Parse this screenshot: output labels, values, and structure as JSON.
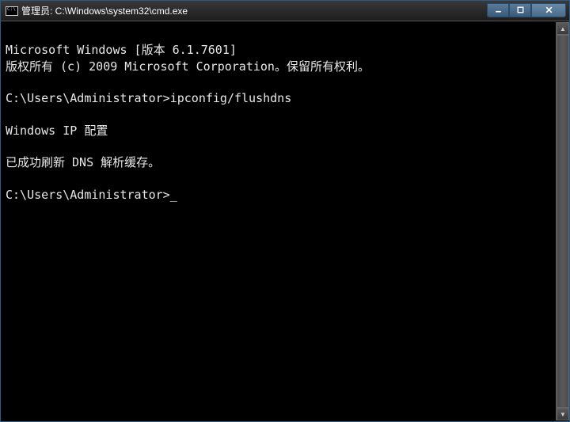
{
  "window": {
    "title": "管理员: C:\\Windows\\system32\\cmd.exe"
  },
  "terminal": {
    "line1": "Microsoft Windows [版本 6.1.7601]",
    "line2": "版权所有 (c) 2009 Microsoft Corporation。保留所有权利。",
    "blank1": "",
    "prompt1_path": "C:\\Users\\Administrator>",
    "prompt1_cmd": "ipconfig/flushdns",
    "blank2": "",
    "header": "Windows IP 配置",
    "blank3": "",
    "result": "已成功刷新 DNS 解析缓存。",
    "blank4": "",
    "prompt2_path": "C:\\Users\\Administrator>",
    "cursor": "_"
  }
}
